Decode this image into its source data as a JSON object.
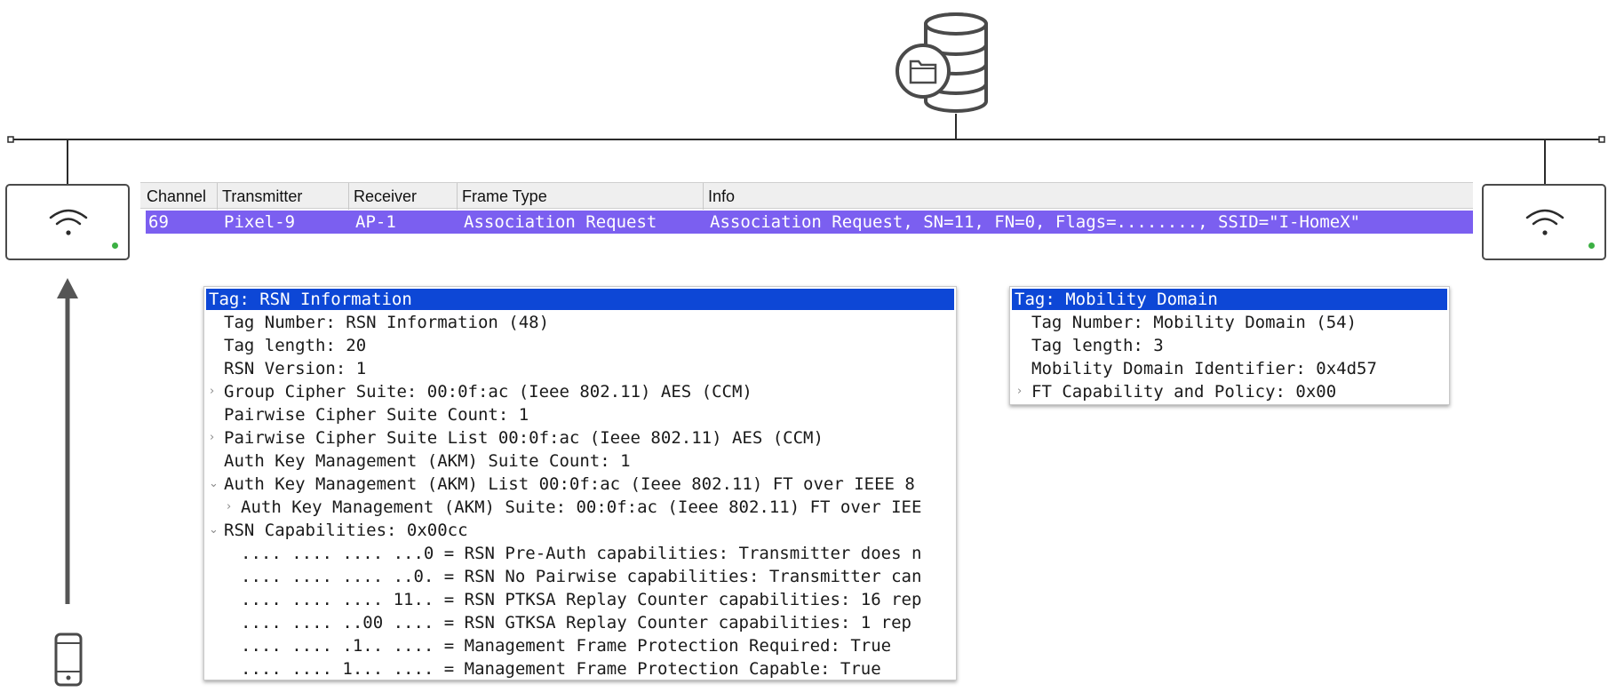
{
  "packet_list": {
    "columns": [
      "Channel",
      "Transmitter",
      "Receiver",
      "Frame Type",
      "Info"
    ],
    "selected_row": {
      "channel": "69",
      "transmitter": "Pixel-9",
      "receiver": "AP-1",
      "frame_type": "Association Request",
      "info": "Association Request, SN=11, FN=0, Flags=........, SSID=\"I-HomeX\""
    },
    "selected_row_color": "#7b5ff0"
  },
  "rsn_panel": {
    "title": "Tag: RSN Information",
    "lines": [
      "Tag Number: RSN Information (48)",
      "Tag length: 20",
      "RSN Version: 1",
      "Group Cipher Suite: 00:0f:ac (Ieee 802.11) AES (CCM)",
      "Pairwise Cipher Suite Count: 1",
      "Pairwise Cipher Suite List 00:0f:ac (Ieee 802.11) AES (CCM)",
      "Auth Key Management (AKM) Suite Count: 1",
      "Auth Key Management (AKM) List 00:0f:ac (Ieee 802.11) FT over IEEE 8",
      "Auth Key Management (AKM) Suite: 00:0f:ac (Ieee 802.11) FT over IEE",
      "RSN Capabilities: 0x00cc",
      ".... .... .... ...0 = RSN Pre-Auth capabilities: Transmitter does n",
      ".... .... .... ..0. = RSN No Pairwise capabilities: Transmitter can",
      ".... .... .... 11.. = RSN PTKSA Replay Counter capabilities: 16 rep",
      ".... .... ..00 .... = RSN GTKSA Replay Counter capabilities: 1 rep",
      ".... .... .1.. .... = Management Frame Protection Required: True",
      ".... .... 1... .... = Management Frame Protection Capable: True"
    ]
  },
  "md_panel": {
    "title": "Tag: Mobility Domain",
    "lines": [
      "Tag Number: Mobility Domain (54)",
      "Tag length: 3",
      "Mobility Domain Identifier: 0x4d57",
      "FT Capability and Policy: 0x00"
    ]
  },
  "colors": {
    "title_highlight": "#0d47d6",
    "ap_led": "#3cb043",
    "diagram_stroke": "#4a4a4a"
  },
  "icons": [
    "database-icon",
    "folder-icon",
    "wifi-icon",
    "phone-icon",
    "arrow-up-icon"
  ]
}
